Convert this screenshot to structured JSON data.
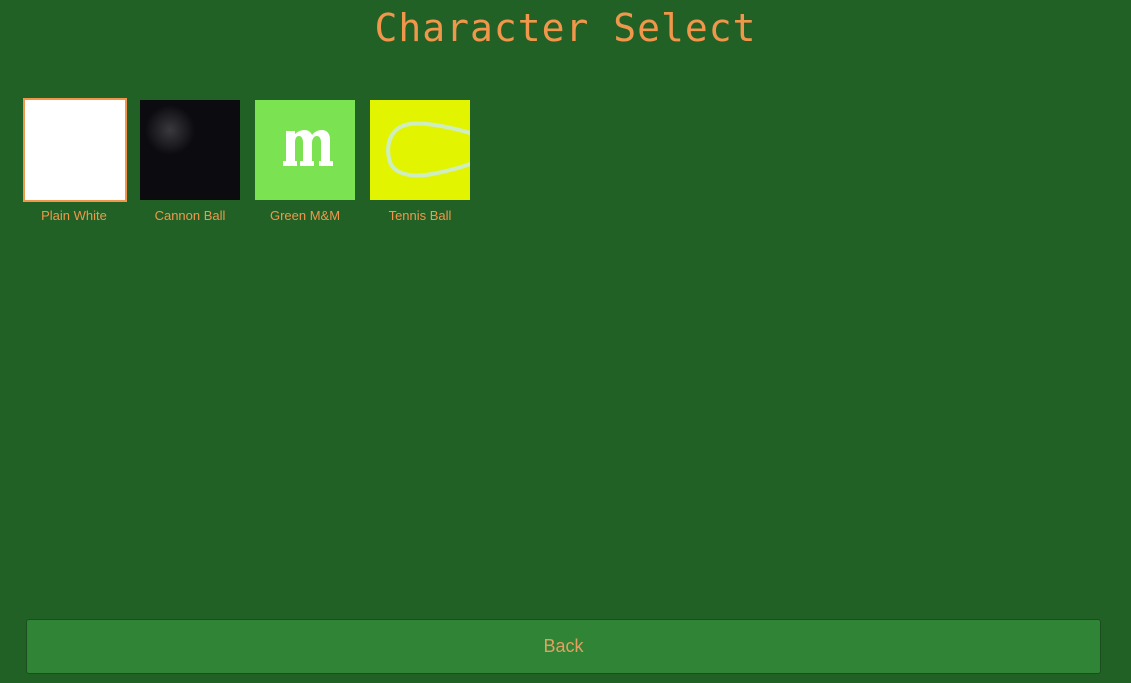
{
  "screen": {
    "title": "Character Select"
  },
  "characters": [
    {
      "label": "Plain White",
      "swatch": "white-swatch",
      "color": "#ffffff",
      "selected": true
    },
    {
      "label": "Cannon Ball",
      "swatch": "cannon-ball-swatch",
      "color": "#0b0b10",
      "selected": false
    },
    {
      "label": "Green M&M",
      "swatch": "green-mm-swatch",
      "color": "#7be251",
      "selected": false
    },
    {
      "label": "Tennis Ball",
      "swatch": "tennis-ball-swatch",
      "color": "#e2f400",
      "selected": false
    }
  ],
  "footer": {
    "back_label": "Back"
  },
  "colors": {
    "background": "#226126",
    "accent": "#f0974c",
    "button": "#2f8436"
  }
}
